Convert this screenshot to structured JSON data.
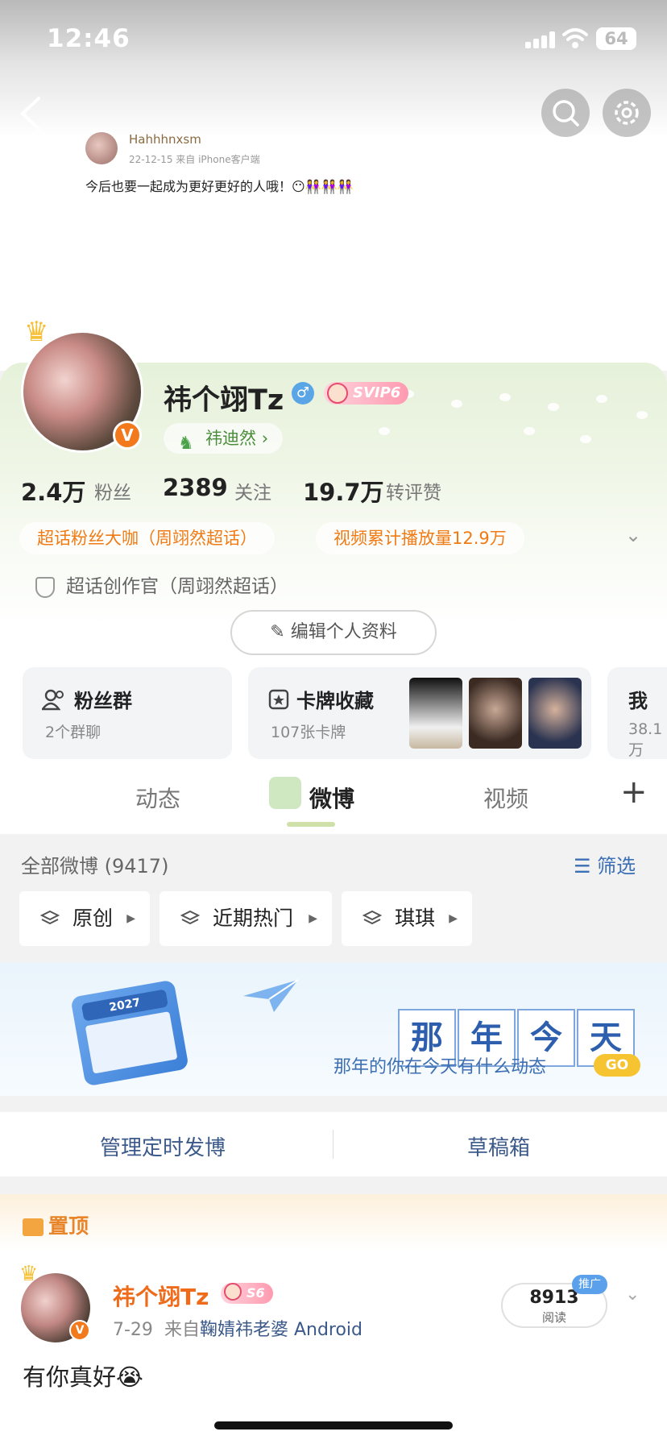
{
  "status_bar": {
    "time": "12:46",
    "battery": "64"
  },
  "cover_post": {
    "username": "Hahhhnxsm",
    "meta": "22-12-15  来自 iPhone客户端",
    "text": "今后也要一起成为更好更好的人哦！😶👭👭👭"
  },
  "profile": {
    "name": "祎个翊Tz",
    "svip": "SVIP6",
    "alias": "祎迪然",
    "stats": [
      {
        "num": "2.4万",
        "label": "粉丝"
      },
      {
        "num": "2389",
        "label": "关注"
      },
      {
        "num": "19.7万",
        "label": "转评赞"
      }
    ],
    "tags": [
      "超话粉丝大咖（周翊然超话）",
      "视频累计播放量12.9万"
    ],
    "creator": "超话创作官（周翊然超话）",
    "edit_button": "编辑个人资料"
  },
  "cards": {
    "fans": {
      "title": "粉丝群",
      "sub": "2个群聊"
    },
    "collect": {
      "title": "卡牌收藏",
      "sub": "107张卡牌"
    },
    "third": {
      "title": "我",
      "sub": "38.1万"
    }
  },
  "tabs": [
    "动态",
    "微博",
    "视频"
  ],
  "feed": {
    "all_label": "全部微博 (9417)",
    "filter_label": "筛选",
    "chips": [
      "原创",
      "近期热门",
      "琪琪"
    ]
  },
  "banner": {
    "year": "2027",
    "chars": [
      "那",
      "年",
      "今",
      "天"
    ],
    "text": "那年的你在今天有什么动态",
    "go": "GO"
  },
  "manage": {
    "scheduled": "管理定时发博",
    "drafts": "草稿箱"
  },
  "pinned": {
    "label": "置顶",
    "name": "祎个翊Tz",
    "vip": "S6",
    "date": "7-29",
    "source_prefix": "来自",
    "source": "鞠婧祎老婆 Android",
    "reads_num": "8913",
    "reads_label": "阅读",
    "promo": "推广",
    "text": "有你真好😭"
  },
  "colors": {
    "accent_orange": "#f07a14",
    "link_blue": "#3b5a8a",
    "green": "#4a8c3a"
  }
}
